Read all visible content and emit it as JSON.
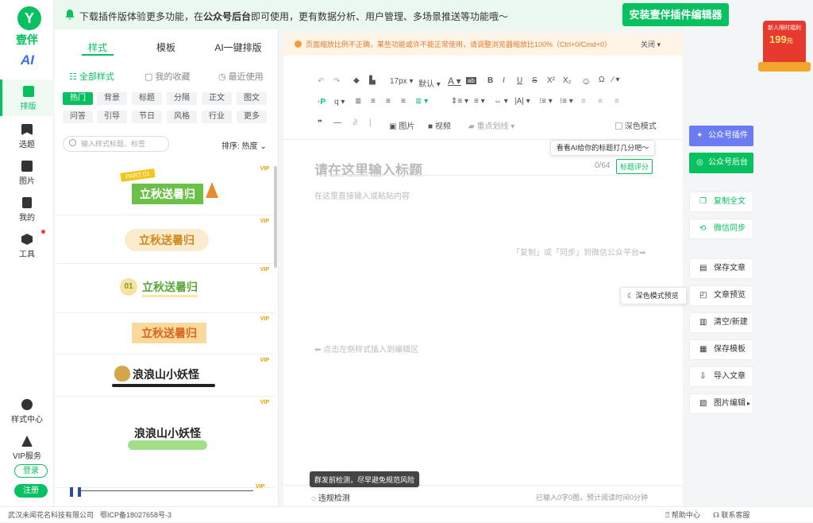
{
  "app": {
    "logo_letter": "Y",
    "logo_text": "壹伴",
    "ai_label": "AI"
  },
  "leftnav": {
    "items": [
      {
        "label": "排版",
        "icon": "layout-icon"
      },
      {
        "label": "选题",
        "icon": "bookmark-icon"
      },
      {
        "label": "图片",
        "icon": "image-icon"
      },
      {
        "label": "我的",
        "icon": "document-icon"
      },
      {
        "label": "工具",
        "icon": "box-icon"
      },
      {
        "label": "样式中心",
        "icon": "palette-icon"
      },
      {
        "label": "VIP服务",
        "icon": "crown-icon"
      }
    ],
    "login": "登录",
    "register": "注册",
    "accent": "#07c160"
  },
  "banner": {
    "text_pre": "下载插件版体验更多功能，在",
    "text_bold": "公众号后台",
    "text_post": "即可使用，更有数据分析、用户管理、多场景推送等功能哦～",
    "install": "安装壹伴插件编辑器"
  },
  "style_panel": {
    "tabs": [
      "样式",
      "模板",
      "AI一键排版"
    ],
    "subtabs": [
      "全部样式",
      "我的收藏",
      "最近使用"
    ],
    "categories": [
      "热门",
      "背景",
      "标题",
      "分隔",
      "正文",
      "图文",
      "问答",
      "引导",
      "节日",
      "风格",
      "行业",
      "更多"
    ],
    "search_placeholder": "输入样式标题、标签",
    "sort_label": "排序: 热度",
    "samples": [
      {
        "tag": "PART.01",
        "text": "立秋送暑归"
      },
      {
        "text": "立秋送暑归"
      },
      {
        "num": "01",
        "text": "立秋送暑归"
      },
      {
        "text": "立秋送暑归"
      },
      {
        "text": "浪浪山小妖怪"
      },
      {
        "text": "浪浪山小妖怪"
      }
    ],
    "vip": "VIP"
  },
  "editor": {
    "notice": "页面缩放比例不正确，某些功能或许不能正常使用，请调整浏览器缩放比100%（Ctrl+0/Cmd+0）",
    "notice_close": "关闭",
    "font_size": "17px",
    "font_family": "默认",
    "image_label": "图片",
    "video_label": "视频",
    "underline_label": "重点划线",
    "dark_mode": "深色模式",
    "title_placeholder": "请在这里输入标题",
    "title_count": "0/64",
    "title_score": "标题评分",
    "ai_tip": "看看AI给你的标题打几分吧～",
    "body_placeholder": "在这里直接输入或粘贴内容",
    "sync_hint": "「复制」或「同步」到微信公众平台➡",
    "insert_hint": "⬅ 点击左侧样式插入到编辑区",
    "check_tip": "群发前检测，尽早避免规范风险",
    "check_label": "违规检测",
    "stats": "已输入0字0图，预计阅读时间0分钟"
  },
  "right": {
    "promo_top": "新人限时福利",
    "promo_price": "199",
    "promo_unit": "元",
    "plugin": "公众号插件",
    "backend": "公众号后台",
    "buttons": [
      "复制全文",
      "微信同步",
      "保存文章",
      "文章预览",
      "清空/新建",
      "保存模板",
      "导入文章",
      "图片编辑"
    ],
    "dark_preview": "深色模式预览"
  },
  "footer": {
    "company": "武汉未闻花名科技有限公司",
    "icp": "鄂ICP备18027658号-3",
    "help": "帮助中心",
    "contact": "联系客服"
  }
}
